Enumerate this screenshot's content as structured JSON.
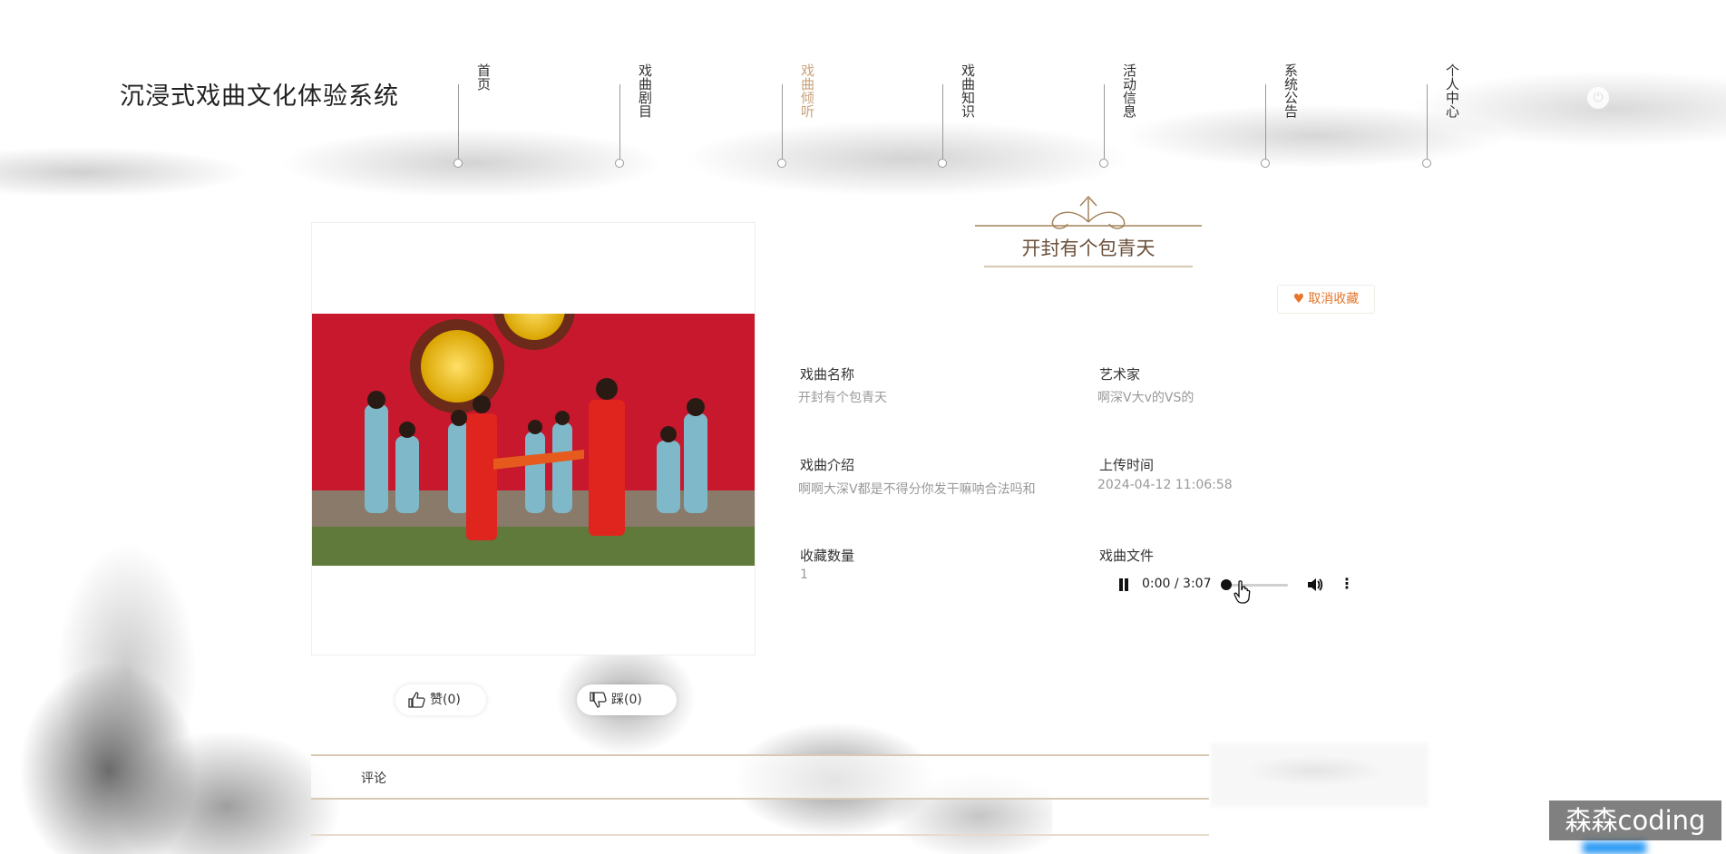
{
  "header": {
    "site_title": "沉浸式戏曲文化体验系统",
    "nav": [
      {
        "label": "首页",
        "active": false
      },
      {
        "label": "戏曲剧目",
        "active": false
      },
      {
        "label": "戏曲倾听",
        "active": true
      },
      {
        "label": "戏曲知识",
        "active": false
      },
      {
        "label": "活动信息",
        "active": false
      },
      {
        "label": "系统公告",
        "active": false
      },
      {
        "label": "个人中心",
        "active": false
      }
    ],
    "power_icon": "power-icon"
  },
  "detail": {
    "title": "开封有个包青天",
    "favorite_button": "取消收藏",
    "fields": {
      "name_label": "戏曲名称",
      "name_value": "开封有个包青天",
      "artist_label": "艺术家",
      "artist_value": "啊深V大v的VS的",
      "intro_label": "戏曲介绍",
      "intro_value": "啊啊大深V都是不得分你发干嘛呐合法吗和",
      "upload_label": "上传时间",
      "upload_value": "2024-04-12 11:06:58",
      "fav_count_label": "收藏数量",
      "fav_count_value": "1",
      "file_label": "戏曲文件"
    },
    "audio": {
      "time": "0:00 / 3:07",
      "progress": 0.0,
      "state": "playing"
    }
  },
  "votes": {
    "like": "赞(0)",
    "dislike": "踩(0)"
  },
  "comments": {
    "label": "评论"
  },
  "watermark": "森森coding",
  "colors": {
    "accent": "#c8a27a",
    "title": "#6b4f3a",
    "favorite": "#e5762a"
  }
}
